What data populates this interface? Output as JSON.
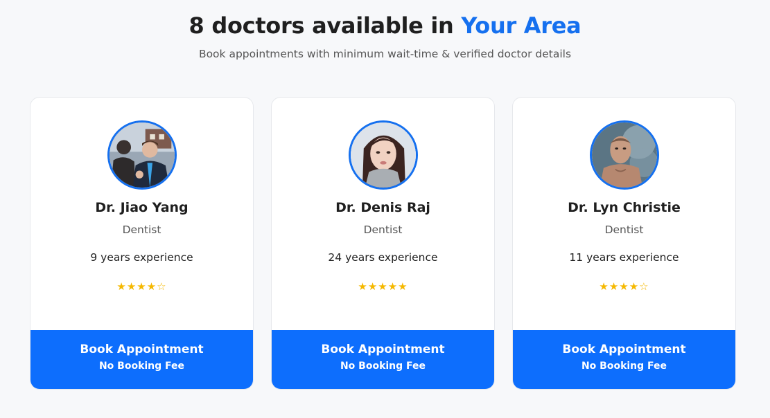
{
  "header": {
    "title_prefix": "8 doctors available in",
    "title_accent": "Your Area",
    "subtitle": "Book appointments with minimum wait-time & verified doctor details"
  },
  "colors": {
    "accent": "#1570ef",
    "button": "#0d6efd",
    "star": "#f5b800"
  },
  "doctors": [
    {
      "name": "Dr. Jiao Yang",
      "specialty": "Dentist",
      "experience": "9 years experience",
      "stars": "★★★★☆",
      "rating": 4,
      "book_label": "Book Appointment",
      "fee_label": "No Booking Fee"
    },
    {
      "name": "Dr. Denis Raj",
      "specialty": "Dentist",
      "experience": "24 years experience",
      "stars": "★★★★★",
      "rating": 5,
      "book_label": "Book Appointment",
      "fee_label": "No Booking Fee"
    },
    {
      "name": "Dr. Lyn Christie",
      "specialty": "Dentist",
      "experience": "11 years experience",
      "stars": "★★★★☆",
      "rating": 4,
      "book_label": "Book Appointment",
      "fee_label": "No Booking Fee"
    }
  ]
}
